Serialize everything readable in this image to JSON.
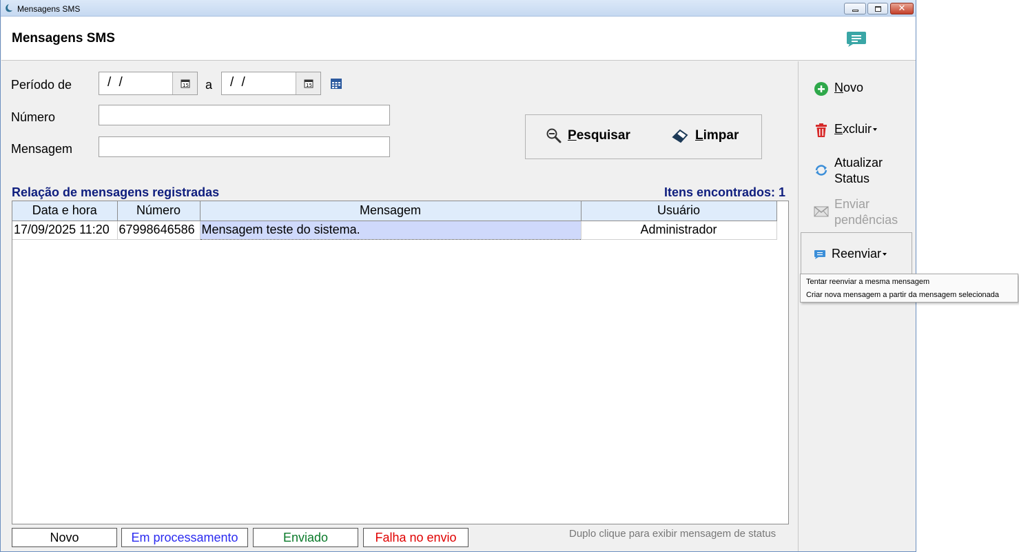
{
  "window": {
    "title": "Mensagens SMS"
  },
  "header": {
    "title": "Mensagens SMS"
  },
  "filters": {
    "period_label": "Período de",
    "date_from": "/ /",
    "to_label": "a",
    "date_to": "/ /",
    "number_label": "Número",
    "number_value": "",
    "message_label": "Mensagem",
    "message_value": ""
  },
  "actions": {
    "search_prefix": "P",
    "search_rest": "esquisar",
    "clear_prefix": "L",
    "clear_rest": "impar"
  },
  "list": {
    "title": "Relação de mensagens registradas",
    "count_text": "Itens encontrados: 1",
    "columns": [
      "Data e hora",
      "Número",
      "Mensagem",
      "Usuário"
    ],
    "rows": [
      {
        "datetime": "17/09/2025 11:20",
        "number": "67998646586",
        "message": "Mensagem teste do sistema.",
        "user": "Administrador"
      }
    ]
  },
  "legend": [
    {
      "label": "Novo",
      "color": "#000000"
    },
    {
      "label": "Em processamento",
      "color": "#2b2bf0"
    },
    {
      "label": "Enviado",
      "color": "#0a7a2a"
    },
    {
      "label": "Falha no envio",
      "color": "#e00000"
    }
  ],
  "status_hint": "Duplo clique para exibir mensagem de status",
  "sidebar": {
    "novo_prefix": "N",
    "novo_rest": "ovo",
    "excluir_prefix": "E",
    "excluir_rest": "xcluir",
    "atualizar_line1": "Atualizar",
    "atualizar_line2": "Status",
    "enviar_line1": "Enviar",
    "enviar_line2": "pendências",
    "reenviar": "Reenviar"
  },
  "dropdown": {
    "items": [
      "Tentar reenviar a mesma mensagem",
      "Criar nova mensagem a partir da mensagem selecionada"
    ]
  },
  "icons": {
    "app": "sms-app-icon",
    "header": "message-icon",
    "calendar": "calendar-icon",
    "search": "search-icon",
    "clear": "eraser-icon",
    "novo": "plus-circle-icon",
    "excluir": "trash-icon",
    "atualizar": "refresh-icon",
    "enviar": "envelope-icon",
    "reenviar": "message-icon"
  },
  "colors": {
    "header_icon": "#3aa6a6",
    "list_title": "#0f1e7e",
    "novo_icon": "#2ea84a",
    "trash_icon": "#d62b2b",
    "refresh_icon": "#3b8ed8"
  }
}
